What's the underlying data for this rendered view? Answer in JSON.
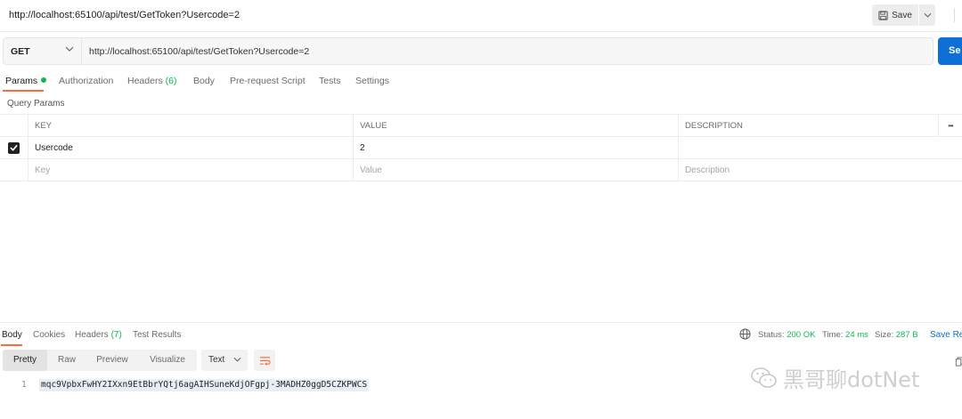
{
  "window": {
    "title": "http://localhost:65100/api/test/GetToken?Usercode=2",
    "save_label": "Save"
  },
  "request": {
    "method": "GET",
    "url": "http://localhost:65100/api/test/GetToken?Usercode=2",
    "send_label": "Se"
  },
  "req_tabs": {
    "params": "Params",
    "authorization": "Authorization",
    "headers": "Headers",
    "headers_count": "(6)",
    "body": "Body",
    "prerequest": "Pre-request Script",
    "tests": "Tests",
    "settings": "Settings"
  },
  "query_params": {
    "label": "Query Params",
    "columns": {
      "key": "KEY",
      "value": "VALUE",
      "description": "DESCRIPTION",
      "more": "•••"
    },
    "rows": [
      {
        "key": "Usercode",
        "value": "2",
        "description": "",
        "checked": true
      }
    ],
    "placeholders": {
      "key": "Key",
      "value": "Value",
      "description": "Description"
    }
  },
  "response": {
    "tabs": {
      "body": "Body",
      "cookies": "Cookies",
      "headers": "Headers",
      "headers_count": "(7)",
      "test_results": "Test Results"
    },
    "status_label": "Status:",
    "status_value": "200 OK",
    "time_label": "Time:",
    "time_value": "24 ms",
    "size_label": "Size:",
    "size_value": "287 B",
    "save_label": "Save Re",
    "formats": {
      "pretty": "Pretty",
      "raw": "Raw",
      "preview": "Preview",
      "visualize": "Visualize"
    },
    "text_type": "Text",
    "line_number": "1",
    "body_text": "mqc9VpbxFwHY2IXxn9EtBbrYQtj6agAIHSuneKdjOFgpj-3MADHZ0ggD5CZKPWCS"
  },
  "watermark": {
    "text": "黑哥聊dotNet",
    "icon": "wechat-icon"
  },
  "colors": {
    "accent_orange": "#ff6c37",
    "send_blue": "#0e6fd6",
    "success_green": "#0cbb52"
  }
}
